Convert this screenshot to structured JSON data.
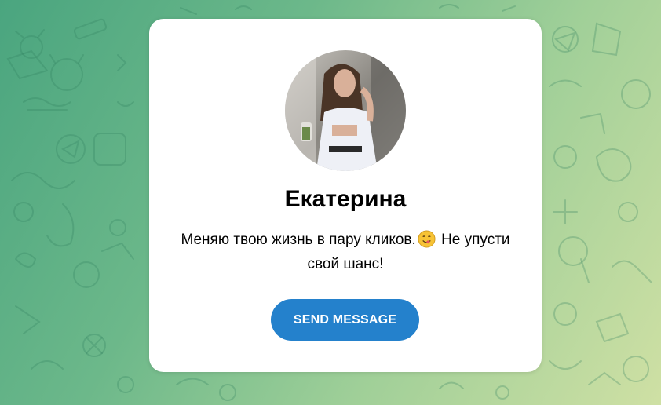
{
  "profile": {
    "name": "Екатерина",
    "bio_part1": "Меняю твою жизнь в пару кликов.",
    "bio_emoji": "face-savoring-food-emoji",
    "bio_part2": " Не упусти свой шанс!"
  },
  "actions": {
    "send_label": "SEND MESSAGE"
  },
  "colors": {
    "button": "#2481cc",
    "background_start": "#4aa57f",
    "background_end": "#cfe0a4",
    "card": "#ffffff"
  }
}
